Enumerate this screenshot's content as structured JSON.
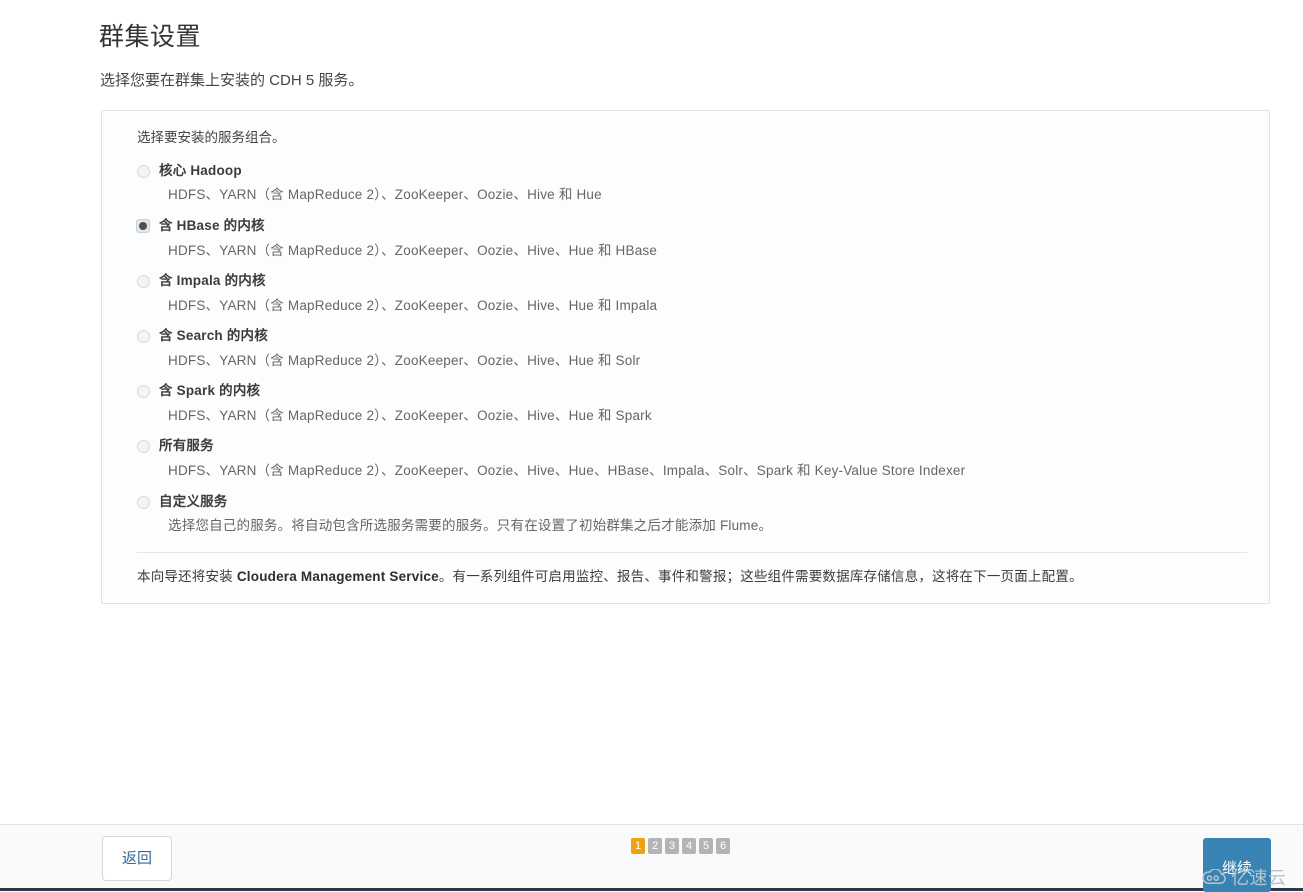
{
  "page": {
    "title": "群集设置",
    "subtitle": "选择您要在群集上安装的 CDH 5 服务。"
  },
  "panel": {
    "intro": "选择要安装的服务组合。",
    "options": [
      {
        "label": "核心 Hadoop",
        "desc": "HDFS、YARN（含 MapReduce 2）、ZooKeeper、Oozie、Hive 和 Hue",
        "selected": false
      },
      {
        "label": "含 HBase 的内核",
        "desc": "HDFS、YARN（含 MapReduce 2）、ZooKeeper、Oozie、Hive、Hue 和 HBase",
        "selected": true
      },
      {
        "label": "含 Impala 的内核",
        "desc": "HDFS、YARN（含 MapReduce 2）、ZooKeeper、Oozie、Hive、Hue 和 Impala",
        "selected": false
      },
      {
        "label": "含 Search 的内核",
        "desc": "HDFS、YARN（含 MapReduce 2）、ZooKeeper、Oozie、Hive、Hue 和 Solr",
        "selected": false
      },
      {
        "label": "含 Spark 的内核",
        "desc": "HDFS、YARN（含 MapReduce 2）、ZooKeeper、Oozie、Hive、Hue 和 Spark",
        "selected": false
      },
      {
        "label": "所有服务",
        "desc": "HDFS、YARN（含 MapReduce 2）、ZooKeeper、Oozie、Hive、Hue、HBase、Impala、Solr、Spark 和 Key-Value Store Indexer",
        "selected": false
      },
      {
        "label": "自定义服务",
        "desc": "选择您自己的服务。将自动包含所选服务需要的服务。只有在设置了初始群集之后才能添加 Flume。",
        "selected": false
      }
    ],
    "note": {
      "before": "本向导还将安装 ",
      "strong": "Cloudera Management Service",
      "after": "。有一系列组件可启用监控、报告、事件和警报；这些组件需要数据库存储信息，这将在下一页面上配置。"
    }
  },
  "footer": {
    "back_label": "返回",
    "continue_label": "继续",
    "steps": [
      "1",
      "2",
      "3",
      "4",
      "5",
      "6"
    ],
    "active_step": 1
  },
  "watermark": {
    "text": "亿速云"
  },
  "colors": {
    "accent_blue": "#3883b3",
    "link_blue": "#33689b",
    "active_step": "#f0a10e",
    "step_grey": "#b4b4b4",
    "panel_border": "#e2e2e2",
    "bottom_rule": "#2b3a47"
  }
}
